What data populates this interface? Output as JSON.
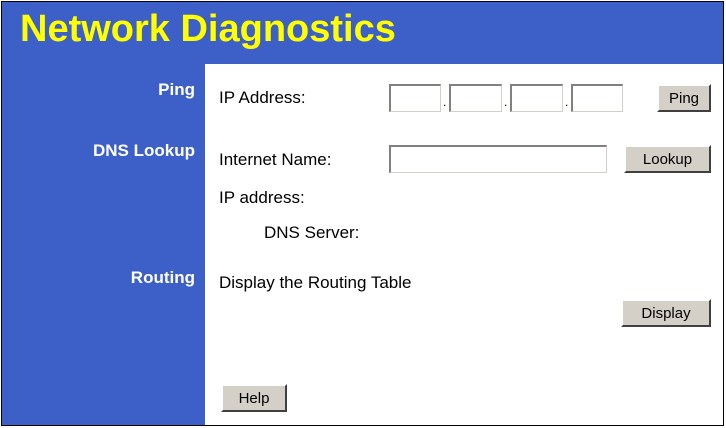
{
  "title": "Network Diagnostics",
  "colors": {
    "banner_bg": "#3d5fc8",
    "title_text": "#ffff00",
    "sidebar_text": "#ffffff",
    "content_bg": "#ffffff",
    "button_face": "#d4d0c8"
  },
  "ping": {
    "section_label": "Ping",
    "ip_label": "IP Address:",
    "octet_1": "",
    "octet_2": "",
    "octet_3": "",
    "octet_4": "",
    "separator": ".",
    "button_label": "Ping"
  },
  "dns": {
    "section_label": "DNS Lookup",
    "internet_name_label": "Internet Name:",
    "internet_name_value": "",
    "button_label": "Lookup",
    "ip_address_label": "IP address:",
    "dns_server_label": "DNS Server:"
  },
  "routing": {
    "section_label": "Routing",
    "description": "Display the Routing Table",
    "button_label": "Display"
  },
  "help": {
    "button_label": "Help"
  }
}
